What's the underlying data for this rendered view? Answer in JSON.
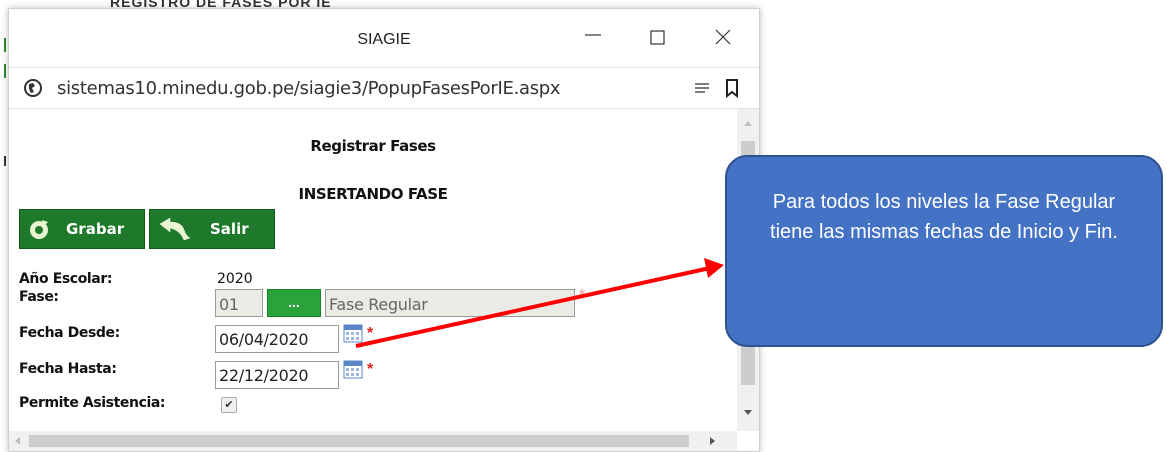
{
  "background": {
    "heading_text": "REGISTRO DE FASES POR IE"
  },
  "window": {
    "title": "SIAGIE",
    "url": "sistemas10.minedu.gob.pe/siagie3/PopupFasesPorIE.aspx",
    "controls": [
      "minimize",
      "maximize",
      "close"
    ]
  },
  "form": {
    "heading": "Registrar Fases",
    "subheading": "INSERTANDO FASE",
    "toolbar": {
      "grabar_label": "Grabar",
      "salir_label": "Salir"
    },
    "fields": {
      "anio_label": "Año Escolar:",
      "anio_value": "2020",
      "fase_label": "Fase:",
      "fase_code": "01",
      "fase_lookup_label": "...",
      "fase_name": "Fase Regular",
      "desde_label": "Fecha Desde:",
      "desde_value": "06/04/2020",
      "hasta_label": "Fecha Hasta:",
      "hasta_value": "22/12/2020",
      "asistencia_label": "Permite Asistencia:",
      "asistencia_checked": true,
      "required_mark": "*"
    }
  },
  "callout": {
    "text": "Para todos los niveles la Fase Regular  tiene las mismas fechas de Inicio y Fin."
  },
  "colors": {
    "button_green": "#1e7a2a",
    "callout_blue": "#4472c4",
    "arrow_red": "#ff0000",
    "required_red": "#e0201b"
  }
}
